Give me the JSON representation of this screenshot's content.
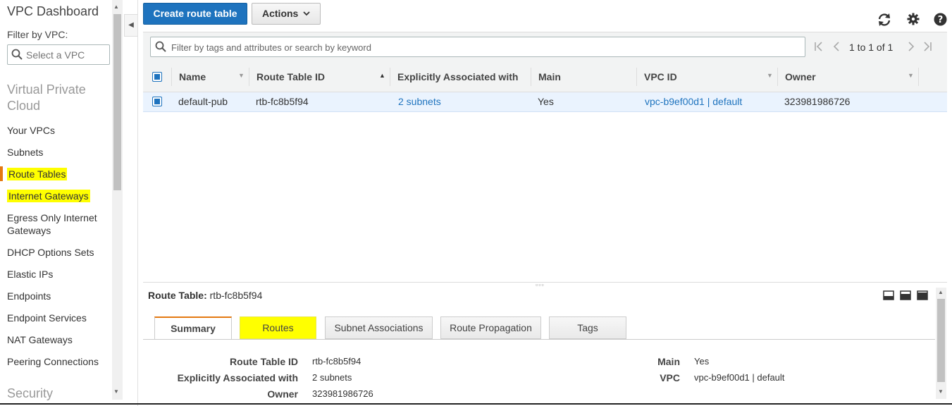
{
  "sidebar": {
    "title": "VPC Dashboard",
    "filter_label": "Filter by VPC:",
    "vpc_select_placeholder": "Select a VPC",
    "section_vpc_line1": "Virtual Private",
    "section_vpc_line2": "Cloud",
    "items": [
      {
        "label": "Your VPCs"
      },
      {
        "label": "Subnets"
      },
      {
        "label": "Route Tables"
      },
      {
        "label": "Internet Gateways"
      },
      {
        "label": "Egress Only Internet Gateways"
      },
      {
        "label": "DHCP Options Sets"
      },
      {
        "label": "Elastic IPs"
      },
      {
        "label": "Endpoints"
      },
      {
        "label": "Endpoint Services"
      },
      {
        "label": "NAT Gateways"
      },
      {
        "label": "Peering Connections"
      }
    ],
    "section_security": "Security"
  },
  "toolbar": {
    "create_label": "Create route table",
    "actions_label": "Actions",
    "refresh_icon": "refresh-icon",
    "settings_icon": "gear-icon",
    "help_icon": "help-icon"
  },
  "filter": {
    "placeholder": "Filter by tags and attributes or search by keyword",
    "pager_text": "1 to 1 of 1"
  },
  "table": {
    "columns": [
      "Name",
      "Route Table ID",
      "Explicitly Associated with",
      "Main",
      "VPC ID",
      "Owner"
    ],
    "rows": [
      {
        "name": "default-pub",
        "route_table_id": "rtb-fc8b5f94",
        "associated": "2 subnets",
        "main": "Yes",
        "vpc_id": "vpc-b9ef00d1 | default",
        "owner": "323981986726"
      }
    ]
  },
  "details": {
    "title_label": "Route Table:",
    "title_value": "rtb-fc8b5f94",
    "tabs": [
      "Summary",
      "Routes",
      "Subnet Associations",
      "Route Propagation",
      "Tags"
    ],
    "summary": {
      "route_table_id_label": "Route Table ID",
      "route_table_id": "rtb-fc8b5f94",
      "associated_label": "Explicitly Associated with",
      "associated": "2 subnets",
      "owner_label": "Owner",
      "owner": "323981986726",
      "main_label": "Main",
      "main": "Yes",
      "vpc_label": "VPC",
      "vpc": "vpc-b9ef00d1 | default"
    }
  },
  "colors": {
    "primary": "#1e73be",
    "highlight": "#ffff00",
    "active_accent": "#e47911",
    "selected_row": "#eaf3fe"
  }
}
